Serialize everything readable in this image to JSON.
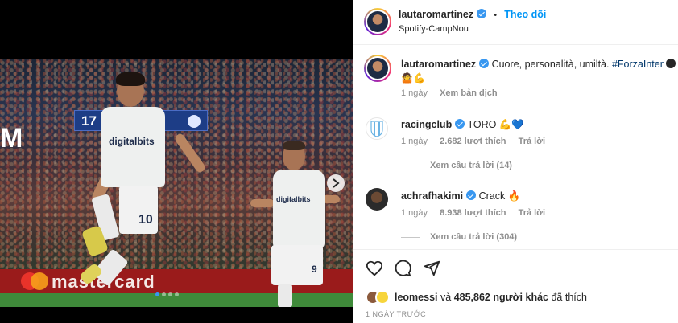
{
  "post": {
    "author": "lautaromartinez",
    "follow_label": "Theo dõi",
    "separator": "•",
    "location": "Spotify-CampNou"
  },
  "caption": {
    "username": "lautaromartinez",
    "text": "Cuore, personalità, umiltà.",
    "hashtag": "#ForzaInter",
    "emoji_line": "🤷💪",
    "time": "1 ngày",
    "translate_label": "Xem bản dịch"
  },
  "comments": [
    {
      "username": "racingclub",
      "text": "TORO 💪💙",
      "time": "1 ngày",
      "likes": "2.682 lượt thích",
      "reply_label": "Trả lời",
      "view_replies": "Xem câu trả lời (14)"
    },
    {
      "username": "achrafhakimi",
      "text": "Crack 🔥",
      "time": "1 ngày",
      "likes": "8.938 lượt thích",
      "reply_label": "Trả lời",
      "view_replies": "Xem câu trả lời (304)"
    }
  ],
  "media": {
    "sponsor_text": "digitalbits",
    "jersey_number_main": "10",
    "jersey_number_second": "9",
    "ad_text": "mastercard",
    "scoreboard_left": "17",
    "carousel_count": 4,
    "carousel_active": 0
  },
  "likes_line": {
    "liker": "leomessi",
    "joiner": "và",
    "count": "485,862 người khác",
    "suffix": "đã thích"
  },
  "timestamp_label": "1 NGÀY TRƯỚC",
  "colors": {
    "accent": "#0095f6",
    "verified": "#3897f0",
    "muted": "#8e8e8e"
  },
  "icons": [
    "heart-icon",
    "comment-icon",
    "share-icon",
    "chevron-right-icon",
    "verified-icon"
  ]
}
